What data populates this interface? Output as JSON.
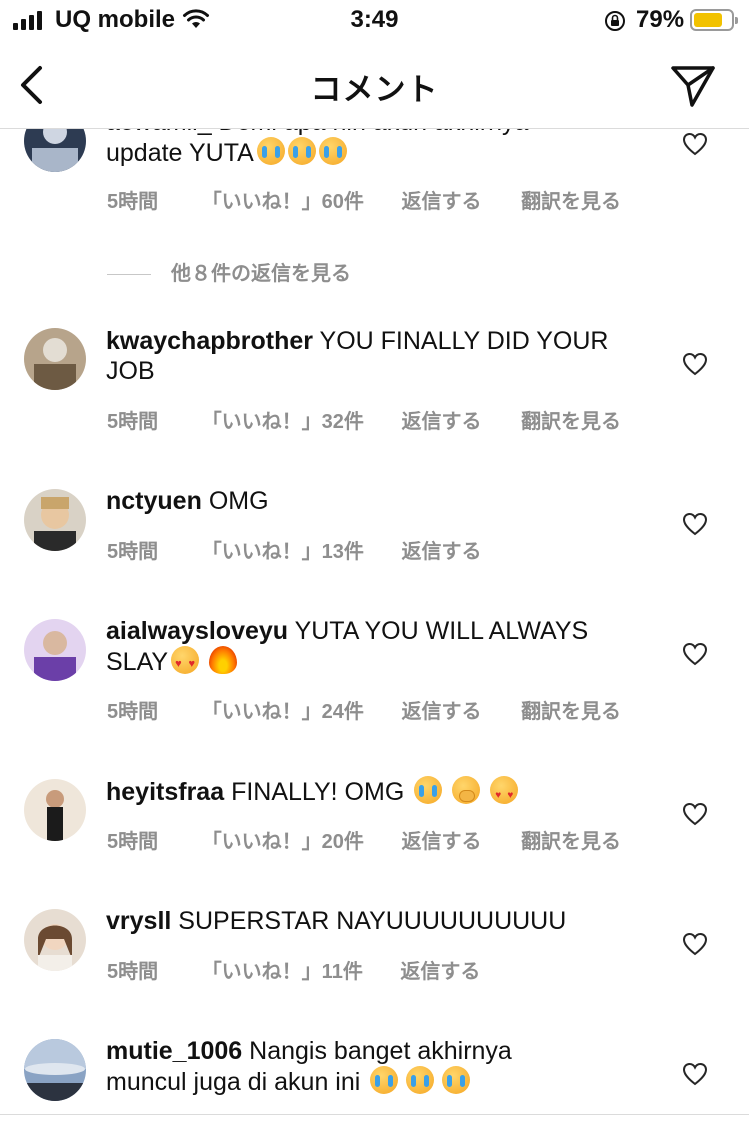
{
  "status_bar": {
    "carrier": "UQ mobile",
    "time": "3:49",
    "battery_pct": "79%",
    "battery_level": 0.79
  },
  "nav": {
    "title": "コメント",
    "back_icon": "chevron-left-icon",
    "send_icon": "paper-plane-icon"
  },
  "comments": [
    {
      "username": "aewamii_",
      "text": "Demi apa nih akun akhirnya update YUTA",
      "line1": "aewamii_ Demi apa nih akun akhirnya",
      "line2": "update YUTA",
      "emojis": [
        "loudly-crying-face",
        "loudly-crying-face",
        "loudly-crying-face"
      ],
      "time": "5時間",
      "likes": "「いいね！」60件",
      "reply": "返信する",
      "translate": "翻訳を見る"
    },
    {
      "username": "kwaychapbrother",
      "text_line1": "YOU FINALLY DID YOUR",
      "text_line2": "JOB",
      "time": "5時間",
      "likes": "「いいね！」32件",
      "reply": "返信する",
      "translate": "翻訳を見る"
    },
    {
      "username": "nctyuen",
      "text": "OMG",
      "time": "5時間",
      "likes": "「いいね！」13件",
      "reply": "返信する"
    },
    {
      "username": "aialwaysloveyu",
      "text_line1": "YUTA YOU WILL ALWAYS",
      "text_line2": "SLAY",
      "emojis": [
        "heart-eyes-face",
        "fire"
      ],
      "time": "5時間",
      "likes": "「いいね！」24件",
      "reply": "返信する",
      "translate": "翻訳を見る"
    },
    {
      "username": "heyitsfraa",
      "text": "FINALLY! OMG",
      "emojis": [
        "loudly-crying-face",
        "face-with-hand-over-mouth",
        "heart-eyes-cat"
      ],
      "time": "5時間",
      "likes": "「いいね！」20件",
      "reply": "返信する",
      "translate": "翻訳を見る"
    },
    {
      "username": "vrysll",
      "text": "SUPERSTAR NAYUUUUUUUUUU",
      "time": "5時間",
      "likes": "「いいね！」11件",
      "reply": "返信する"
    },
    {
      "username": "mutie_1006",
      "text_line1": "Nangis banget akhirnya",
      "text_line2": "muncul juga di akun ini",
      "emojis": [
        "loudly-crying-face",
        "loudly-crying-face",
        "loudly-crying-face"
      ]
    }
  ],
  "view_replies": "他８件の返信を見る",
  "colors": {
    "meta_gray": "#8e8e8e",
    "divider": "#dbdbdb",
    "battery": "#f2c200"
  }
}
